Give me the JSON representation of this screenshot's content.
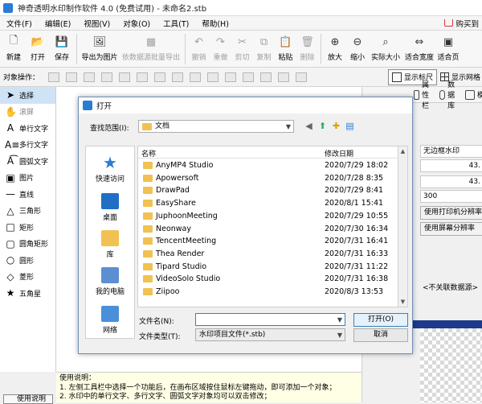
{
  "window": {
    "title": "神奇透明水印制作软件 4.0 (免费试用) - 未命名2.stb"
  },
  "menu": {
    "items": [
      "文件(F)",
      "编辑(E)",
      "视图(V)",
      "对象(O)",
      "工具(T)",
      "帮助(H)"
    ],
    "buy": "购买到"
  },
  "toolbar": {
    "buttons": [
      {
        "label": "新建",
        "icon": "new-file-icon",
        "disabled": false
      },
      {
        "label": "打开",
        "icon": "open-folder-icon",
        "disabled": false
      },
      {
        "label": "保存",
        "icon": "save-icon",
        "disabled": false
      },
      {
        "label": "导出为图片",
        "icon": "export-image-icon",
        "disabled": false
      },
      {
        "label": "依数据源批量导出",
        "icon": "batch-export-icon",
        "disabled": true
      },
      {
        "label": "撤销",
        "icon": "undo-icon",
        "disabled": true
      },
      {
        "label": "重做",
        "icon": "redo-icon",
        "disabled": true
      },
      {
        "label": "剪切",
        "icon": "cut-icon",
        "disabled": true
      },
      {
        "label": "复制",
        "icon": "copy-icon",
        "disabled": true
      },
      {
        "label": "粘贴",
        "icon": "paste-icon",
        "disabled": false
      },
      {
        "label": "删除",
        "icon": "delete-icon",
        "disabled": true
      },
      {
        "label": "放大",
        "icon": "zoom-in-icon",
        "disabled": false
      },
      {
        "label": "缩小",
        "icon": "zoom-out-icon",
        "disabled": false
      },
      {
        "label": "实际大小",
        "icon": "actual-size-icon",
        "disabled": false
      },
      {
        "label": "适合宽度",
        "icon": "fit-width-icon",
        "disabled": false
      },
      {
        "label": "适合页",
        "icon": "fit-page-icon",
        "disabled": false
      }
    ]
  },
  "toolbar2": {
    "label": "对象操作：",
    "show_ruler": "显示标尺",
    "show_grid": "显示网格"
  },
  "left_tools": [
    {
      "label": "选择",
      "icon": "pointer-icon",
      "selected": true
    },
    {
      "label": "滚屏",
      "icon": "hand-icon",
      "dim": true
    },
    {
      "label": "单行文字",
      "icon": "text-line-icon"
    },
    {
      "label": "多行文字",
      "icon": "text-multiline-icon"
    },
    {
      "label": "圆弧文字",
      "icon": "arc-text-icon"
    },
    {
      "label": "图片",
      "icon": "image-icon"
    },
    {
      "label": "直线",
      "icon": "line-icon"
    },
    {
      "label": "三角形",
      "icon": "triangle-icon"
    },
    {
      "label": "矩形",
      "icon": "rectangle-icon"
    },
    {
      "label": "圆角矩形",
      "icon": "rounded-rect-icon"
    },
    {
      "label": "圆形",
      "icon": "circle-icon"
    },
    {
      "label": "菱形",
      "icon": "diamond-icon"
    },
    {
      "label": "五角星",
      "icon": "star-icon"
    }
  ],
  "right_panel": {
    "tabs": [
      {
        "label": "属性栏",
        "icon": "properties-icon"
      },
      {
        "label": "数据库",
        "icon": "database-icon"
      },
      {
        "label": "模",
        "icon": "template-icon"
      }
    ],
    "fields": [
      "无边框水印",
      "43.",
      "43.",
      "300"
    ],
    "buttons": [
      "使用打印机分辨率",
      "使用屏幕分辨率"
    ],
    "datasource": "<不关联数据源>"
  },
  "bottom_info": {
    "lines": [
      "使用说明：",
      "1. 左侧工具栏中选择一个功能后，在画布区域按住鼠标左键拖动，即可添加一个对象；",
      "2. 水印中的单行文字、多行文字、圆弧文字对象均可以双击修改；"
    ],
    "help_button": "使用说明"
  },
  "dialog": {
    "title": "打开",
    "look_in_label": "查找范围(I):",
    "look_in_value": "文档",
    "places": [
      "快速访问",
      "桌面",
      "库",
      "我的电脑",
      "网络"
    ],
    "columns": {
      "name": "名称",
      "modified": "修改日期"
    },
    "files": [
      {
        "name": "AnyMP4 Studio",
        "date": "2020/7/29 18:02"
      },
      {
        "name": "Apowersoft",
        "date": "2020/7/28 8:35"
      },
      {
        "name": "DrawPad",
        "date": "2020/7/29 8:41"
      },
      {
        "name": "EasyShare",
        "date": "2020/8/1 15:41"
      },
      {
        "name": "JuphoonMeeting",
        "date": "2020/7/29 10:55"
      },
      {
        "name": "Neonway",
        "date": "2020/7/30 16:34"
      },
      {
        "name": "TencentMeeting",
        "date": "2020/7/31 16:41"
      },
      {
        "name": "Thea Render",
        "date": "2020/7/31 16:33"
      },
      {
        "name": "Tipard Studio",
        "date": "2020/7/31 11:22"
      },
      {
        "name": "VideoSolo Studio",
        "date": "2020/7/31 16:38"
      },
      {
        "name": "Ziipoo",
        "date": "2020/8/3 13:53"
      }
    ],
    "filename_label": "文件名(N):",
    "filename_value": "",
    "filetype_label": "文件类型(T):",
    "filetype_value": "水印项目文件(*.stb)",
    "open_button": "打开(O)",
    "cancel_button": "取消"
  },
  "colors": {
    "accent": "#2b7cd3",
    "selection": "#cfe3f7",
    "folder": "#f1c152",
    "info_bg": "#ffffe6"
  }
}
